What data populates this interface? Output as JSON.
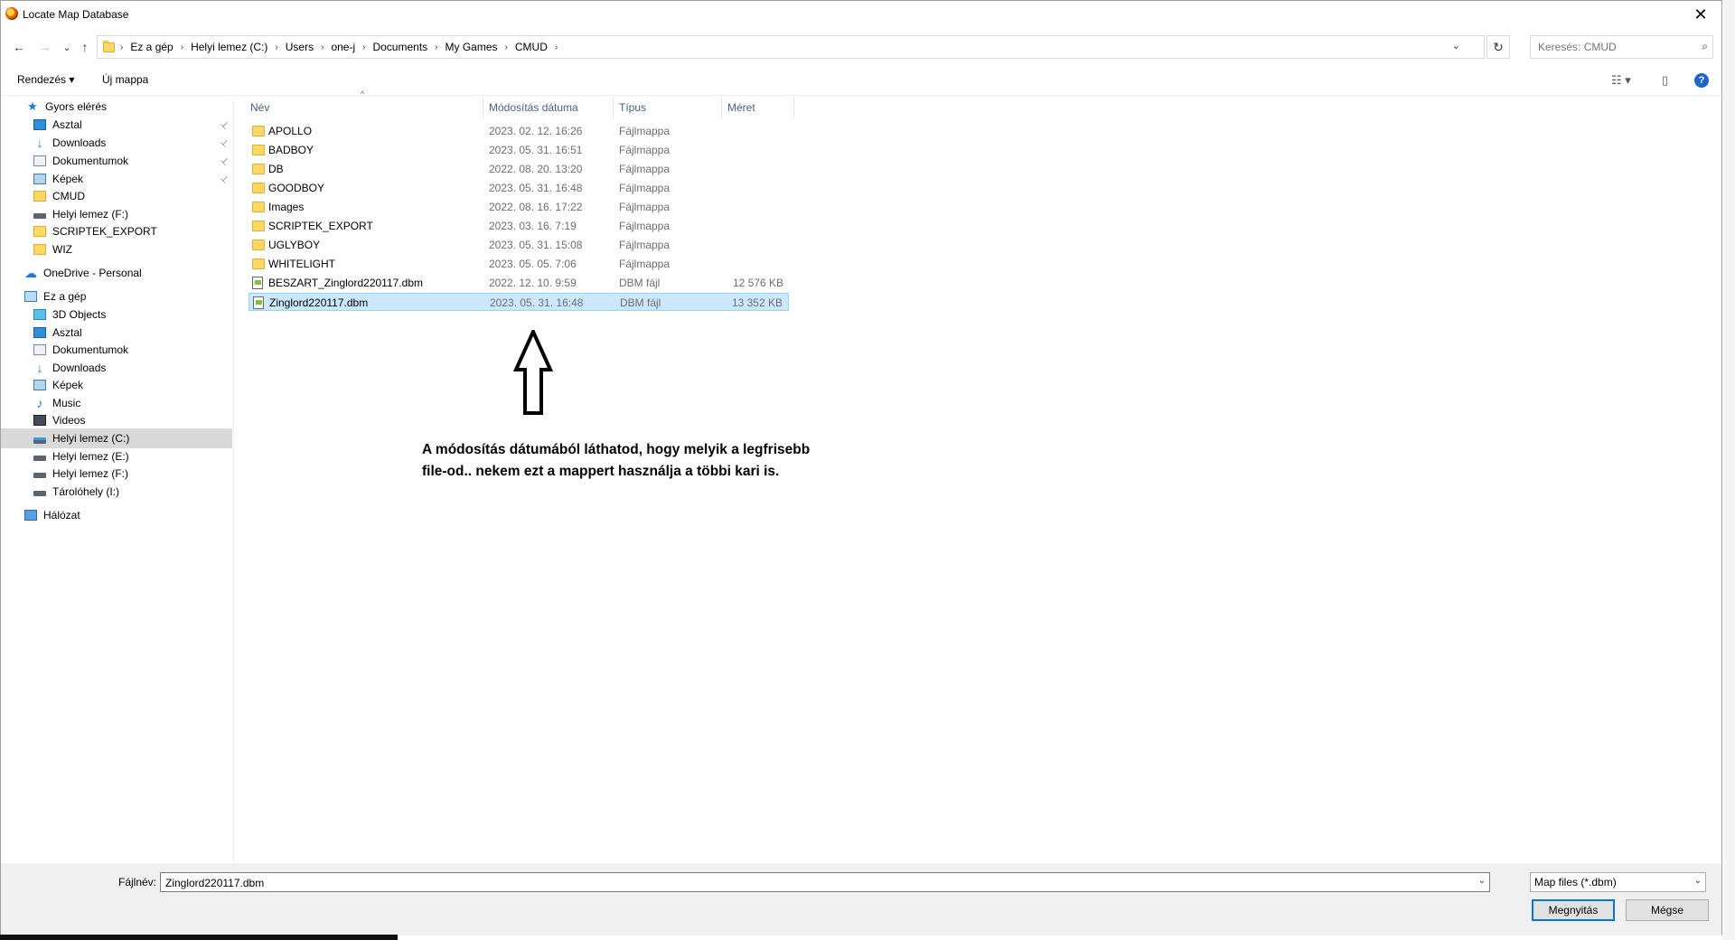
{
  "window": {
    "title": "Locate Map Database",
    "close": "✕"
  },
  "nav": {
    "back": "←",
    "forward": "→",
    "recent": "⌄",
    "up": "↑"
  },
  "breadcrumbs": [
    "Ez a gép",
    "Helyi lemez (C:)",
    "Users",
    "one-j",
    "Documents",
    "My Games",
    "CMUD"
  ],
  "address_dropdown": "⌄",
  "refresh": "↻",
  "search": {
    "placeholder": "Keresés: CMUD",
    "icon": "⌕"
  },
  "toolbar": {
    "organize": "Rendezés ▾",
    "new_folder": "Új mappa",
    "view": "☷ ▾",
    "pane": "▯",
    "help": "?"
  },
  "sidebar": {
    "items": [
      {
        "label": "Gyors elérés",
        "icon": "star-icon"
      },
      {
        "label": "Asztal",
        "icon": "desktop-icon",
        "pinned": true
      },
      {
        "label": "Downloads",
        "icon": "download-icon",
        "pinned": true
      },
      {
        "label": "Dokumentumok",
        "icon": "documents-icon",
        "pinned": true
      },
      {
        "label": "Képek",
        "icon": "pictures-icon",
        "pinned": true
      },
      {
        "label": "CMUD",
        "icon": "folder-icon"
      },
      {
        "label": "Helyi lemez (F:)",
        "icon": "drive-icon"
      },
      {
        "label": "SCRIPTEK_EXPORT",
        "icon": "folder-icon"
      },
      {
        "label": "WIZ",
        "icon": "folder-icon"
      },
      {
        "label": "OneDrive - Personal",
        "icon": "cloud-icon"
      },
      {
        "label": "Ez a gép",
        "icon": "computer-icon"
      },
      {
        "label": "3D Objects",
        "icon": "3d-objects-icon"
      },
      {
        "label": "Asztal",
        "icon": "desktop-icon"
      },
      {
        "label": "Dokumentumok",
        "icon": "documents-icon"
      },
      {
        "label": "Downloads",
        "icon": "download-icon"
      },
      {
        "label": "Képek",
        "icon": "pictures-icon"
      },
      {
        "label": "Music",
        "icon": "music-icon"
      },
      {
        "label": "Videos",
        "icon": "videos-icon"
      },
      {
        "label": "Helyi lemez (C:)",
        "icon": "system-drive-icon",
        "selected": true
      },
      {
        "label": "Helyi lemez (E:)",
        "icon": "drive-icon"
      },
      {
        "label": "Helyi lemez (F:)",
        "icon": "drive-icon"
      },
      {
        "label": "Tárolóhely (I:)",
        "icon": "drive-icon"
      },
      {
        "label": "Hálózat",
        "icon": "network-icon"
      }
    ],
    "pin_glyph": "📌"
  },
  "columns": {
    "name": "Név",
    "modified": "Módosítás dátuma",
    "type": "Típus",
    "size": "Méret",
    "sort_glyph": "^"
  },
  "files": [
    {
      "name": "APOLLO",
      "modified": "2023. 02. 12. 16:26",
      "type": "Fájlmappa",
      "size": "",
      "kind": "folder"
    },
    {
      "name": "BADBOY",
      "modified": "2023. 05. 31. 16:51",
      "type": "Fájlmappa",
      "size": "",
      "kind": "folder"
    },
    {
      "name": "DB",
      "modified": "2022. 08. 20. 13:20",
      "type": "Fájlmappa",
      "size": "",
      "kind": "folder"
    },
    {
      "name": "GOODBOY",
      "modified": "2023. 05. 31. 16:48",
      "type": "Fájlmappa",
      "size": "",
      "kind": "folder"
    },
    {
      "name": "Images",
      "modified": "2022. 08. 16. 17:22",
      "type": "Fájlmappa",
      "size": "",
      "kind": "folder"
    },
    {
      "name": "SCRIPTEK_EXPORT",
      "modified": "2023. 03. 16. 7:19",
      "type": "Fájlmappa",
      "size": "",
      "kind": "folder"
    },
    {
      "name": "UGLYBOY",
      "modified": "2023. 05. 31. 15:08",
      "type": "Fájlmappa",
      "size": "",
      "kind": "folder"
    },
    {
      "name": "WHITELIGHT",
      "modified": "2023. 05. 05. 7:06",
      "type": "Fájlmappa",
      "size": "",
      "kind": "folder"
    },
    {
      "name": "BESZART_Zinglord220117.dbm",
      "modified": "2022. 12. 10. 9:59",
      "type": "DBM fájl",
      "size": "12 576 KB",
      "kind": "file"
    },
    {
      "name": "Zinglord220117.dbm",
      "modified": "2023. 05. 31. 16:48",
      "type": "DBM fájl",
      "size": "13 352 KB",
      "kind": "file",
      "selected": true
    }
  ],
  "annotation": {
    "line1": "A módosítás dátumából láthatod, hogy melyik a legfrisebb",
    "line2": "file-od.. nekem ezt a mappert használja a többi kari is."
  },
  "footer": {
    "filename_label": "Fájlnév:",
    "filename_value": "Zinglord220117.dbm",
    "filetype": "Map files (*.dbm)",
    "open": "Megnyitás",
    "cancel": "Mégse",
    "dropdown": "⌄"
  }
}
